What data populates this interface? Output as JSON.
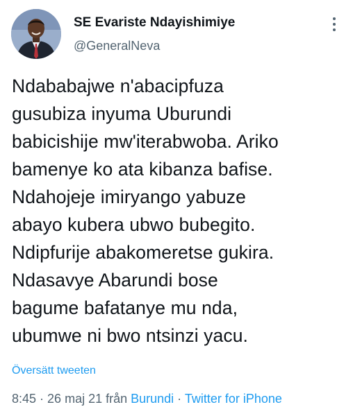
{
  "author": {
    "name": "SE Evariste Ndayishimiye",
    "handle": "@GeneralNeva"
  },
  "tweet": {
    "lines": [
      "Ndababajwe n'abacipfuza",
      "gusubiza inyuma Uburundi",
      "babicishije mw'iterabwoba. Ariko",
      "bamenye ko ata kibanza bafise.",
      "Ndahojeje imiryango yabuze",
      "abayo kubera ubwo bubegito.",
      "Ndipfurije abakomeretse gukira.",
      "Ndasavye Abarundi bose",
      "bagume bafatanye mu nda,",
      "ubumwe ni bwo ntsinzi yacu."
    ],
    "translate_label": "Översätt tweeten"
  },
  "meta": {
    "time": "8:45",
    "sep1": " · ",
    "date": "26 maj 21 från ",
    "location": "Burundi",
    "sep2": " · ",
    "source": "Twitter for iPhone"
  },
  "icons": {
    "more": "more-vertical-icon"
  },
  "colors": {
    "link": "#1d9bf0",
    "secondary": "#536471",
    "text": "#0f1419"
  }
}
